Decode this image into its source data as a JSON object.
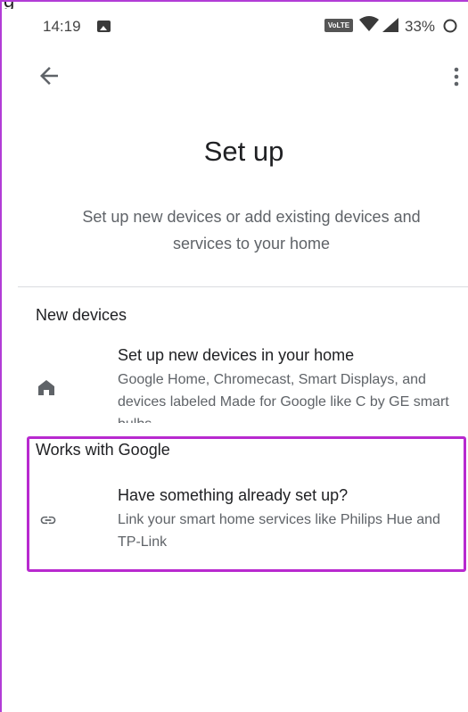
{
  "status_bar": {
    "time": "14:19",
    "volte": "VoLTE",
    "battery": "33%"
  },
  "toolbar": {
    "back_icon": "arrow-back-icon",
    "more_icon": "more-vert-icon"
  },
  "page": {
    "title": "Set up",
    "subtitle": "Set up new devices or add existing devices and services to your home"
  },
  "sections": {
    "new_devices": {
      "header": "New devices",
      "icon": "home-icon",
      "title": "Set up new devices in your home",
      "description": "Google Home, Chromecast, Smart Displays, and devices labeled Made for Google like C by GE smart bulbs"
    },
    "works_with_google": {
      "header": "Works with Google",
      "icon": "link-icon",
      "title": "Have something already set up?",
      "description": "Link your smart home services like Philips Hue and TP-Link"
    }
  },
  "colors": {
    "highlight": "#b829cf",
    "text_primary": "#202124",
    "text_secondary": "#5f6368"
  }
}
